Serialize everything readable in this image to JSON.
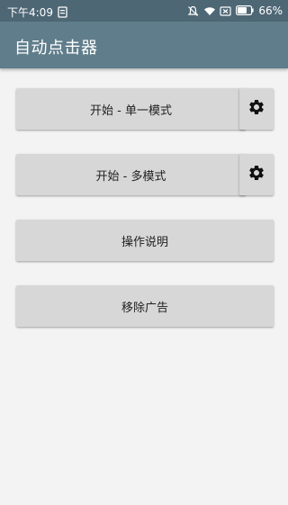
{
  "statusbar": {
    "time": "下午4:09",
    "battery": "66%",
    "icons": [
      "notification-icon",
      "mute-bell-icon",
      "wifi-icon",
      "sim-disabled-icon",
      "battery-icon"
    ]
  },
  "appbar": {
    "title": "自动点击器"
  },
  "buttons": {
    "start_single": "开始 - 单一模式",
    "start_multi": "开始 - 多模式",
    "instructions": "操作说明",
    "remove_ads": "移除广告"
  },
  "colors": {
    "statusbar": "#4e6775",
    "appbar": "#607d8b",
    "background": "#f3f3f3",
    "button": "#d7d7d7"
  }
}
